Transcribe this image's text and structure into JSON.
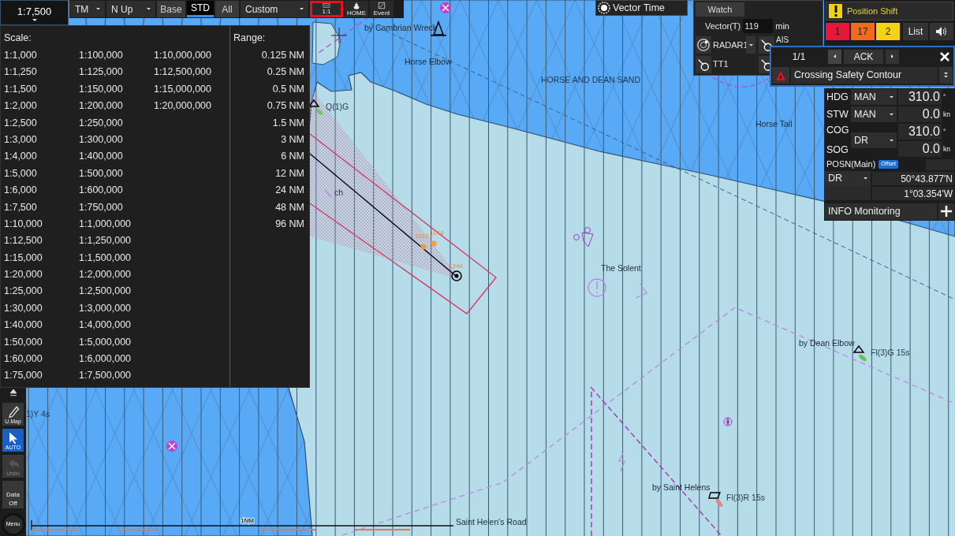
{
  "scale_box": {
    "value": "1:7,500"
  },
  "toolbar": {
    "items": [
      {
        "kind": "dropdown",
        "label": "TM"
      },
      {
        "kind": "dropdown",
        "label": "N Up"
      },
      {
        "kind": "tab",
        "label": "Base",
        "selected": false
      },
      {
        "kind": "tab",
        "label": "STD",
        "selected": true
      },
      {
        "kind": "tab",
        "label": "All",
        "selected": false
      },
      {
        "kind": "dropdown",
        "label": "Custom"
      }
    ],
    "icon_buttons": [
      {
        "kind": "chart",
        "caption": "1:1",
        "highlighted": true
      },
      {
        "kind": "ship",
        "caption": "HOME",
        "highlighted": false
      },
      {
        "kind": "event",
        "caption": "Event",
        "highlighted": false
      }
    ]
  },
  "scale_panel": {
    "scale_heading": "Scale:",
    "range_heading": "Range:",
    "scale_columns": [
      [
        "1:1,000",
        "1:1,250",
        "1:1,500",
        "1:2,000",
        "1:2,500",
        "1:3,000",
        "1:4,000",
        "1:5,000",
        "1:6,000",
        "1:7,500",
        "1:10,000",
        "1:12,500",
        "1:15,000",
        "1:20,000",
        "1:25,000",
        "1:30,000",
        "1:40,000",
        "1:50,000",
        "1:60,000",
        "1:75,000"
      ],
      [
        "1:100,000",
        "1:125,000",
        "1:150,000",
        "1:200,000",
        "1:250,000",
        "1:300,000",
        "1:400,000",
        "1:500,000",
        "1:600,000",
        "1:750,000",
        "1:1,000,000",
        "1:1,250,000",
        "1:1,500,000",
        "1:2,000,000",
        "1:2,500,000",
        "1:3,000,000",
        "1:4,000,000",
        "1:5,000,000",
        "1:6,000,000",
        "1:7,500,000"
      ],
      [
        "1:10,000,000",
        "1:12,500,000",
        "1:15,000,000",
        "1:20,000,000"
      ]
    ],
    "ranges": [
      "0.125 NM",
      "0.25 NM",
      "0.5 NM",
      "0.75 NM",
      "1.5 NM",
      "3 NM",
      "6 NM",
      "12 NM",
      "24 NM",
      "48 NM",
      "96 NM"
    ]
  },
  "vector_time": {
    "label": "Vector Time"
  },
  "watch": {
    "tab": "Watch",
    "vector_label": "Vector(T)",
    "vector_value": "119",
    "vector_unit": "min",
    "sensors": [
      {
        "kind": "radar",
        "label": "RADAR1",
        "dropdown": true
      },
      {
        "kind": "target",
        "label": "TT1",
        "dropdown": false
      }
    ],
    "ais_label": "AIS"
  },
  "alerts": {
    "banner": "Position Shift",
    "counts": [
      {
        "value": "1",
        "color": "#e8173a"
      },
      {
        "value": "17",
        "color": "#f26b1d"
      },
      {
        "value": "2",
        "color": "#f5d312"
      }
    ],
    "list_label": "List",
    "popup": {
      "page": "1/1",
      "ack": "ACK",
      "message": "Crossing Safety Contour"
    }
  },
  "nav": {
    "rows": [
      {
        "label": "HDG",
        "source": "MAN",
        "value": "310.0",
        "unit": "°"
      },
      {
        "label": "STW",
        "source": "MAN",
        "value": "0.0",
        "unit": "kn"
      }
    ],
    "cog_sog": {
      "source": "DR",
      "rows": [
        {
          "label": "COG",
          "value": "310.0",
          "unit": "°"
        },
        {
          "label": "SOG",
          "value": "0.0",
          "unit": "kn"
        }
      ]
    },
    "posn": {
      "label": "POSN(Main)",
      "badge": "Offset",
      "source": "DR",
      "lat": "50°43.877'N",
      "lon": "1°03.354'W"
    },
    "info": "INFO Monitoring"
  },
  "left_tools": [
    {
      "kind": "pencil",
      "label": "U.Map",
      "selected": false,
      "disabled": false
    },
    {
      "kind": "cursor",
      "label": "AUTO",
      "selected": true,
      "disabled": false
    },
    {
      "kind": "undo",
      "label": "Undo",
      "selected": false,
      "disabled": true
    },
    {
      "kind": "text",
      "label": "Data Off",
      "selected": false,
      "disabled": false
    },
    {
      "kind": "menu",
      "label": "Menu",
      "selected": false,
      "disabled": false
    }
  ],
  "chart_labels": [
    {
      "kind": "name",
      "text": "by Cambrian Wreck"
    },
    {
      "kind": "name",
      "text": "Horse Elbow"
    },
    {
      "kind": "area",
      "text": "HORSE AND DEAN SAND"
    },
    {
      "kind": "name",
      "text": "Horse Tail"
    },
    {
      "kind": "light",
      "text": "Q(1)G"
    },
    {
      "kind": "light",
      "text": "ch"
    },
    {
      "kind": "track",
      "text": "1013"
    },
    {
      "kind": "track",
      "text": "1014"
    },
    {
      "kind": "track",
      "text": "1244"
    },
    {
      "kind": "name",
      "text": "The Solent"
    },
    {
      "kind": "name",
      "text": "by Dean Elbow"
    },
    {
      "kind": "light",
      "text": "Fl(3)G 15s"
    },
    {
      "kind": "name",
      "text": "by Saint Helens"
    },
    {
      "kind": "light",
      "text": "Fl(3)R 15s"
    },
    {
      "kind": "name",
      "text": "Saint Helen's Road"
    },
    {
      "kind": "light",
      "text": "1)Y 4s"
    },
    {
      "kind": "scale",
      "text": "1NM"
    }
  ]
}
